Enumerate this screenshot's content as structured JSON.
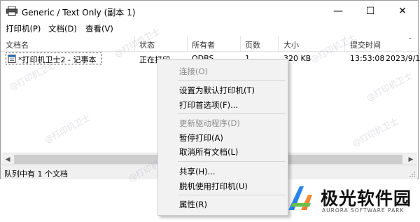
{
  "window": {
    "title": "Generic / Text Only (副本 1)",
    "controls": {
      "minimize": "—",
      "maximize": "☐",
      "close": "✕"
    }
  },
  "menubar": {
    "items": [
      "打印机(P)",
      "文档(D)",
      "查看(V)"
    ]
  },
  "table": {
    "columns": [
      "文档名",
      "状态",
      "所有者",
      "页数",
      "大小",
      "提交时间"
    ],
    "rows": [
      {
        "name": "*打印机卫士2 - 记事本",
        "status": "正在打印",
        "owner": "ODBS",
        "pages": "1",
        "size": "320 KB",
        "time": "13:53:08",
        "date": "2023/9/1"
      }
    ]
  },
  "statusbar": {
    "text": "队列中有 1 个文档"
  },
  "context_menu": {
    "items": [
      {
        "label": "连接(O)",
        "disabled": true
      },
      {
        "label": "设置为默认打印机(T)",
        "disabled": false
      },
      {
        "label": "打印首选项(F)...",
        "disabled": false
      },
      {
        "label": "更新驱动程序(D)",
        "disabled": true
      },
      {
        "label": "暂停打印(A)",
        "disabled": false
      },
      {
        "label": "取消所有文档(L)",
        "disabled": false
      },
      {
        "label": "共享(H)...",
        "disabled": false
      },
      {
        "label": "脱机使用打印机(U)",
        "disabled": false
      },
      {
        "label": "属性(R)",
        "disabled": false
      }
    ]
  },
  "watermark": {
    "text": "@打印机卫士"
  },
  "logo": {
    "name": "极光软件园",
    "subtitle": "AURORA SOFTWARE PARK"
  },
  "colors": {
    "accent": "#1a7fd4",
    "logo_text": "#111111"
  },
  "icons": {
    "app": "printer-icon",
    "grip": "resize-grip-icon",
    "doc": "document-icon"
  }
}
